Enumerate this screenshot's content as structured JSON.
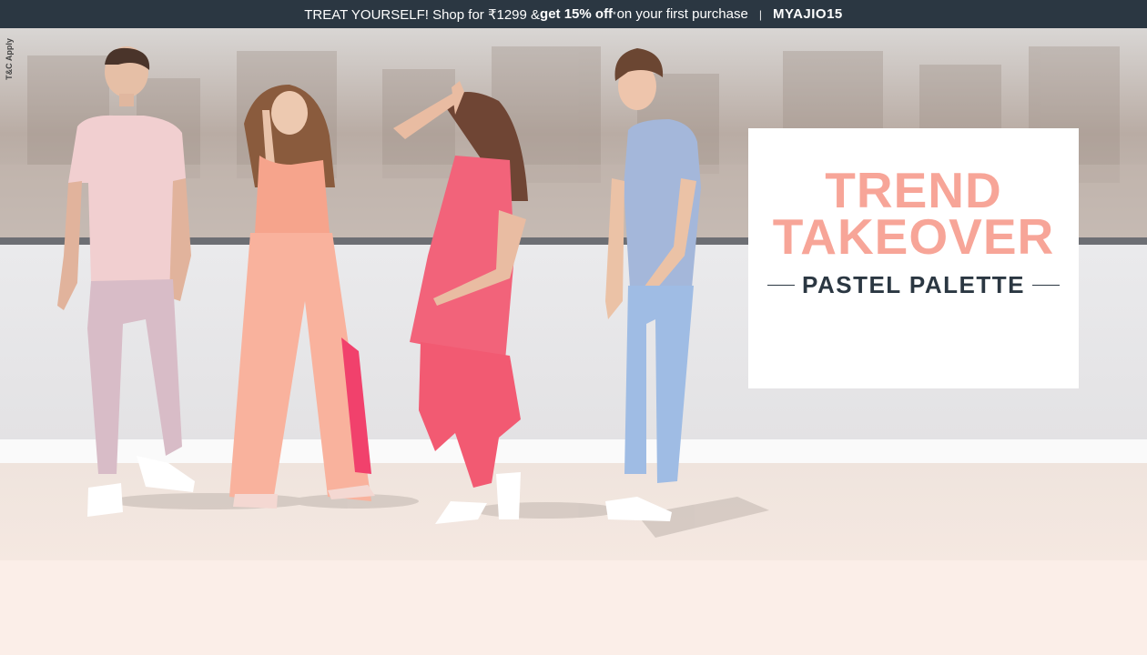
{
  "offer_bar": {
    "text_pre": "TREAT YOURSELF! Shop for ₹1299 & ",
    "discount": "get 15% off",
    "asterisk": "*",
    "text_post": "on your first purchase",
    "separator": "|",
    "coupon_code": "MYAJIO15"
  },
  "hero": {
    "tnc_label": "T&C Apply",
    "title_line1": "TREND",
    "title_line2": "TAKEOVER",
    "subtitle": "PASTEL PALETTE",
    "models": [
      "model-man-pink-tee",
      "model-woman-peach-jumpsuit",
      "model-woman-pink-tunic",
      "model-man-blue-tee"
    ]
  },
  "colors": {
    "top_bar": "#2b3742",
    "title_accent": "#f7a598",
    "subtitle_text": "#2b3742",
    "card_bg": "#ffffff",
    "page_bg": "#fbeee8"
  }
}
